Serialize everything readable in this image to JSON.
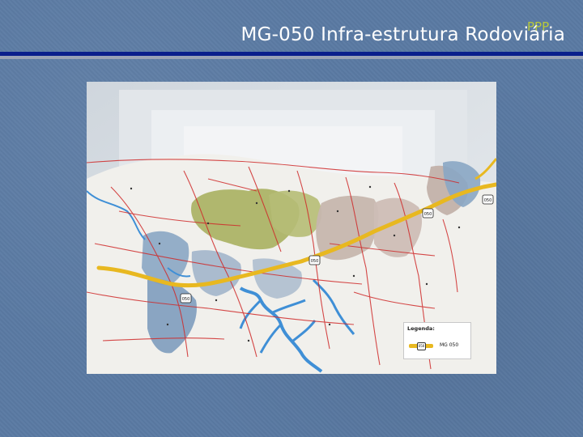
{
  "slide": {
    "title": "MG-050 Infra-estrutura Rodoviária",
    "logo_text": "PPP"
  },
  "map": {
    "highway_color": "#e8b820",
    "road_color": "#cf2a2a",
    "water_color": "#3f8fd6",
    "region_colors": [
      "#a9b060",
      "#c6b6ae",
      "#8aa6c4"
    ],
    "shield_labels": [
      "050",
      "050",
      "050",
      "050"
    ],
    "legend": {
      "title": "Legenda:",
      "shield": "050",
      "item_label": "MG 050"
    }
  }
}
